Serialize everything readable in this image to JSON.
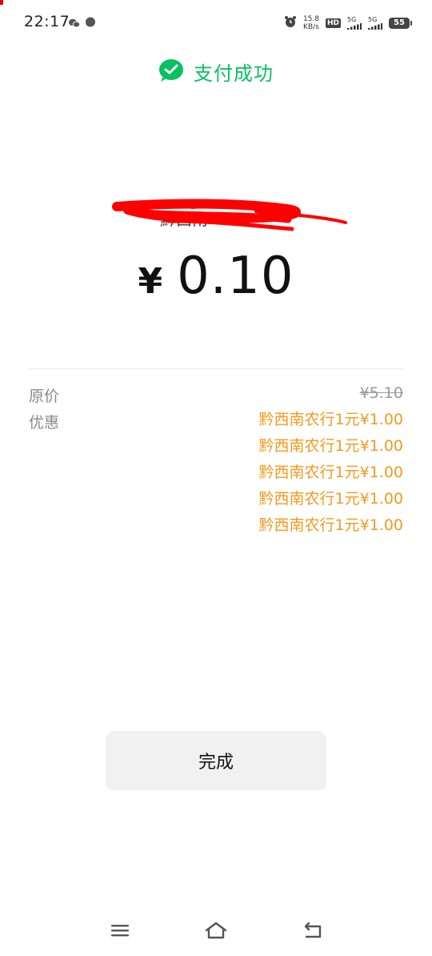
{
  "status_bar": {
    "time": "22:17",
    "net_speed_value": "15.8",
    "net_speed_unit": "KB/s",
    "hd_label": "HD",
    "sig1_label": "5G",
    "sig2_label": "5G",
    "battery": "55"
  },
  "header": {
    "title": "支付成功"
  },
  "payment": {
    "merchant_name": "黔西南",
    "currency_symbol": "¥",
    "amount": "0.10"
  },
  "details": {
    "original_price_label": "原价",
    "original_price_value": "¥5.10",
    "discount_label": "优惠",
    "discounts": [
      "黔西南农行1元¥1.00",
      "黔西南农行1元¥1.00",
      "黔西南农行1元¥1.00",
      "黔西南农行1元¥1.00",
      "黔西南农行1元¥1.00"
    ]
  },
  "done_button": {
    "label": "完成"
  },
  "colors": {
    "wechat_green": "#07c160",
    "discount_orange": "#f39a1e",
    "redaction_red": "#ff0000"
  },
  "icons": {
    "header": "wechat-pay-icon",
    "nav_menu": "menu-icon",
    "nav_home": "home-icon",
    "nav_back": "back-icon"
  }
}
